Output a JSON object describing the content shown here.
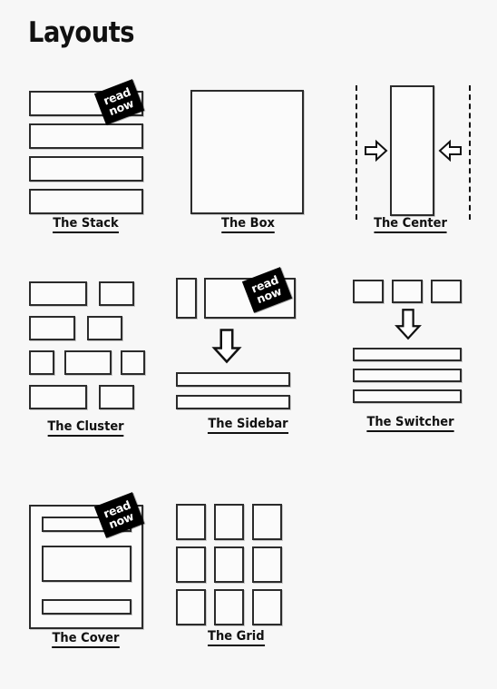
{
  "page": {
    "title": "Layouts",
    "background_color": "#f7f7f7",
    "ink_color": "#2b2b2b",
    "badge_bg": "#000000",
    "badge_fg": "#ffffff"
  },
  "badge": {
    "line1": "read",
    "line2": "now"
  },
  "layouts": [
    {
      "id": "stack",
      "label": "The Stack",
      "has_badge": true,
      "icons": [
        "rectangle-outline",
        "rectangle-outline",
        "rectangle-outline",
        "rectangle-outline"
      ]
    },
    {
      "id": "box",
      "label": "The Box",
      "has_badge": false,
      "icons": [
        "square-outline"
      ]
    },
    {
      "id": "center",
      "label": "The Center",
      "has_badge": false,
      "icons": [
        "dashed-line",
        "rectangle-outline",
        "dashed-line",
        "arrow-right",
        "arrow-left"
      ]
    },
    {
      "id": "cluster",
      "label": "The Cluster",
      "has_badge": false,
      "icons": [
        "rectangle-outline",
        "rectangle-outline",
        "rectangle-outline",
        "rectangle-outline",
        "rectangle-outline",
        "rectangle-outline",
        "rectangle-outline",
        "rectangle-outline",
        "rectangle-outline"
      ]
    },
    {
      "id": "sidebar",
      "label": "The Sidebar",
      "has_badge": true,
      "icons": [
        "rectangle-outline",
        "rectangle-outline",
        "arrow-down",
        "bar-outline",
        "bar-outline"
      ]
    },
    {
      "id": "switcher",
      "label": "The Switcher",
      "has_badge": false,
      "icons": [
        "rectangle-outline",
        "rectangle-outline",
        "rectangle-outline",
        "arrow-down",
        "bar-outline",
        "bar-outline",
        "bar-outline"
      ]
    },
    {
      "id": "cover",
      "label": "The Cover",
      "has_badge": true,
      "icons": [
        "frame-outline",
        "bar-outline",
        "rectangle-outline",
        "bar-outline"
      ]
    },
    {
      "id": "grid",
      "label": "The Grid",
      "has_badge": false,
      "icons": [
        "square-outline",
        "square-outline",
        "square-outline",
        "square-outline",
        "square-outline",
        "square-outline",
        "square-outline",
        "square-outline",
        "square-outline"
      ]
    }
  ]
}
